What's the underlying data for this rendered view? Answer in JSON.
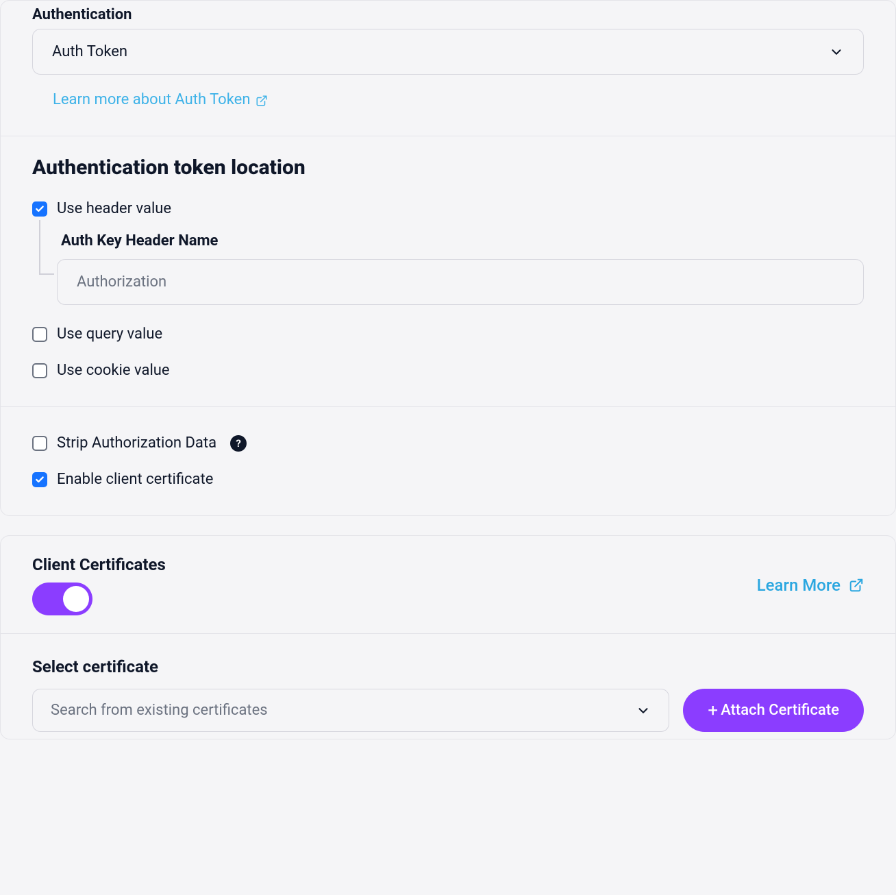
{
  "authentication": {
    "label": "Authentication",
    "selected": "Auth Token",
    "learn_more": "Learn more about Auth Token"
  },
  "token_location": {
    "heading": "Authentication token location",
    "use_header": {
      "label": "Use header value",
      "checked": true,
      "field_label": "Auth Key Header Name",
      "placeholder": "Authorization"
    },
    "use_query": {
      "label": "Use query value",
      "checked": false
    },
    "use_cookie": {
      "label": "Use cookie value",
      "checked": false
    }
  },
  "options": {
    "strip_auth": {
      "label": "Strip Authorization Data",
      "checked": false,
      "help": "?"
    },
    "enable_client_cert": {
      "label": "Enable client certificate",
      "checked": true
    }
  },
  "client_certs": {
    "title": "Client Certificates",
    "toggle_on": true,
    "learn_more": "Learn More",
    "select_label": "Select certificate",
    "select_placeholder": "Search from existing certificates",
    "attach_button": "Attach Certificate"
  },
  "colors": {
    "accent_purple": "#8b3dff",
    "accent_blue": "#1673ff",
    "link_blue": "#3db2e8",
    "text": "#0f1729"
  }
}
